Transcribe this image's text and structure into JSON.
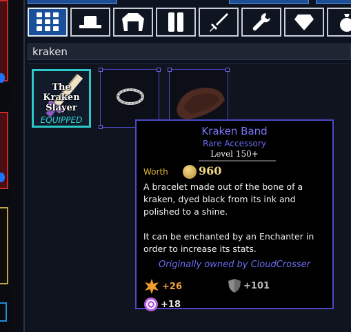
{
  "tabs": [
    {
      "icon": "grid-icon",
      "active": true
    },
    {
      "icon": "hat-icon",
      "active": false
    },
    {
      "icon": "shirt-icon",
      "active": false
    },
    {
      "icon": "pants-icon",
      "active": false
    },
    {
      "icon": "sword-icon",
      "active": false
    },
    {
      "icon": "wrench-icon",
      "active": false
    },
    {
      "icon": "gem-icon",
      "active": false
    },
    {
      "icon": "bag-icon",
      "active": false
    }
  ],
  "search": {
    "value": "kraken"
  },
  "items": [
    {
      "title": "The Kraken Slayer",
      "status": "EQUIPPED"
    },
    {
      "art": "ring"
    },
    {
      "art": "hide"
    }
  ],
  "tooltip": {
    "name": "Kraken Band",
    "rarity": "Rare Accessory",
    "level": "Level 150+",
    "worth_label": "Worth",
    "worth_value": "960",
    "description": "A bracelet made out of the bone of a kraken, dyed black from its ink and polished to a shine.\n\nIt can be enchanted by an Enchanter in order to increase its stats.",
    "owner": "Originally owned by CloudCrosser",
    "stats": [
      {
        "icon": "damage-star-icon",
        "value": "+26"
      },
      {
        "icon": "defense-shield-icon",
        "value": "+101"
      },
      {
        "icon": "target-icon",
        "value": "+18"
      }
    ]
  },
  "colors": {
    "rare": "#6d6bf0",
    "equipped": "#33d6d5",
    "worth": "#e0b63a",
    "tab_active": "#1a4f9a"
  }
}
